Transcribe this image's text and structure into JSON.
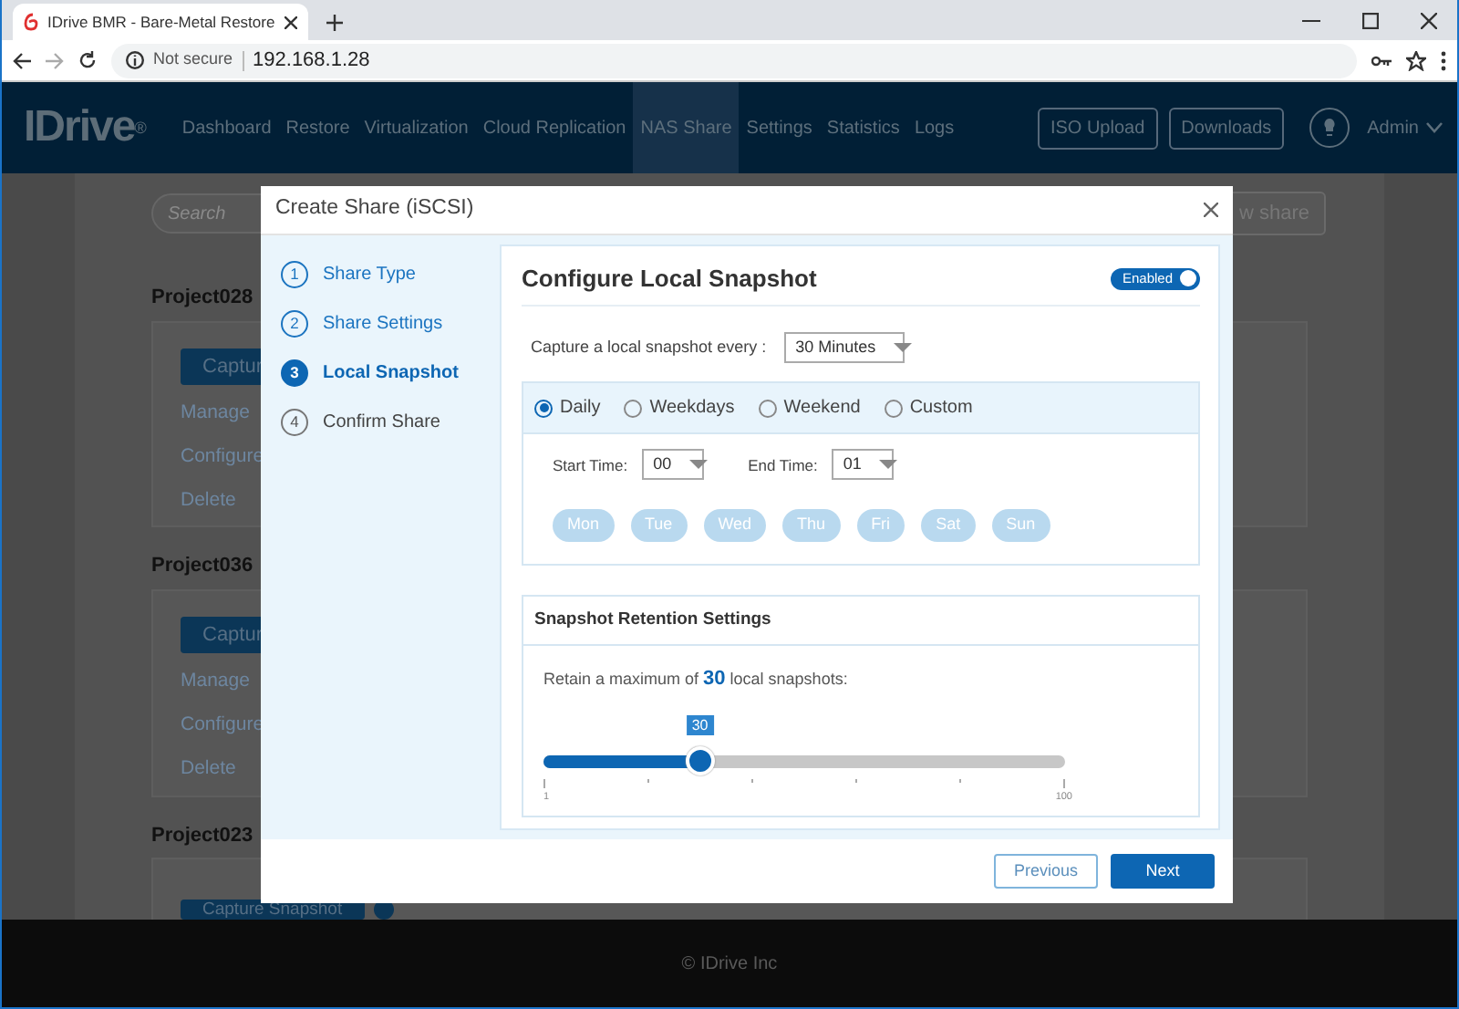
{
  "browser": {
    "tab_title": "IDrive BMR - Bare-Metal Restore",
    "security": "Not secure",
    "url": "192.168.1.28"
  },
  "navbar": {
    "logo": "IDrive",
    "logo_mark": "®",
    "items": [
      {
        "label": "Dashboard",
        "selected": false
      },
      {
        "label": "Restore",
        "selected": false
      },
      {
        "label": "Virtualization",
        "selected": false
      },
      {
        "label": "Cloud Replication",
        "selected": false
      },
      {
        "label": "NAS Share",
        "selected": true
      },
      {
        "label": "Settings",
        "selected": false
      },
      {
        "label": "Statistics",
        "selected": false
      },
      {
        "label": "Logs",
        "selected": false
      }
    ],
    "buttons": [
      "ISO Upload",
      "Downloads"
    ],
    "user": "Admin"
  },
  "background": {
    "search_placeholder": "Search",
    "new_share_button": "w share",
    "projects": [
      {
        "name": "Project028",
        "capture_button": "Captur",
        "links": [
          "Manage",
          "Configure",
          "Delete"
        ]
      },
      {
        "name": "Project036",
        "capture_button": "Captur",
        "links": [
          "Manage",
          "Configure",
          "Delete"
        ]
      },
      {
        "name": "Project023",
        "capture_button": "Capture Snapshot"
      }
    ]
  },
  "modal": {
    "title": "Create Share (iSCSI)",
    "steps": [
      {
        "number": "1",
        "label": "Share Type",
        "completed": true,
        "selected": false
      },
      {
        "number": "2",
        "label": "Share Settings",
        "completed": true,
        "selected": false
      },
      {
        "number": "3",
        "label": "Local Snapshot",
        "completed": false,
        "selected": true
      },
      {
        "number": "4",
        "label": "Confirm Share",
        "completed": false,
        "selected": false
      }
    ],
    "heading": "Configure Local Snapshot",
    "toggle": {
      "label": "Enabled",
      "on": true
    },
    "capture_label": "Capture a local snapshot every :",
    "capture_value": "30 Minutes",
    "schedules": [
      {
        "label": "Daily",
        "selected": true
      },
      {
        "label": "Weekdays",
        "selected": false
      },
      {
        "label": "Weekend",
        "selected": false
      },
      {
        "label": "Custom",
        "selected": false
      }
    ],
    "start_label": "Start Time:",
    "start_value": "00",
    "end_label": "End Time:",
    "end_value": "01",
    "days": [
      {
        "label": "Mon",
        "selected": false
      },
      {
        "label": "Tue",
        "selected": false
      },
      {
        "label": "Wed",
        "selected": false
      },
      {
        "label": "Thu",
        "selected": false
      },
      {
        "label": "Fri",
        "selected": false
      },
      {
        "label": "Sat",
        "selected": false
      },
      {
        "label": "Sun",
        "selected": false
      }
    ],
    "retention": {
      "heading": "Snapshot Retention Settings",
      "text": "Retain a maximum of **30** local snapshots:",
      "slider": {
        "level": 0.3,
        "tooltip": "30",
        "min_label": "1",
        "max_label": "100"
      }
    },
    "buttons": {
      "previous": "Previous",
      "next": "Next"
    }
  },
  "footer": "© IDrive Inc"
}
